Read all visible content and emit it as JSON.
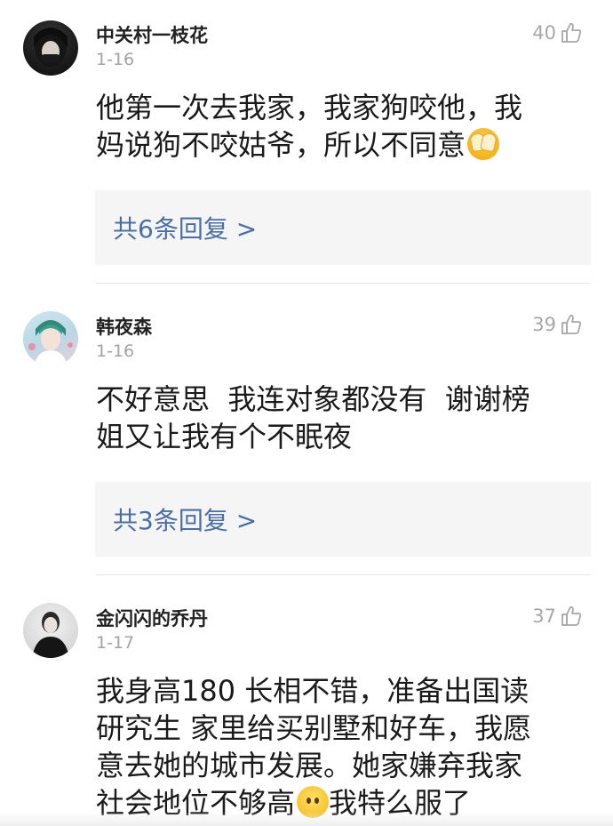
{
  "comments": [
    {
      "username": "中关村一枝花",
      "date": "1-16",
      "likes": "40",
      "avatar": "dark-hair-girl-avatar",
      "lines": [
        "他第一次去我家，我家狗咬他，我",
        "妈说狗不咬姑爷，所以不同意"
      ],
      "emoji": "face-covering-eyes-emoji",
      "replies": "共6条回复 >"
    },
    {
      "username": "韩夜森",
      "date": "1-16",
      "likes": "39",
      "avatar": "anime-character-avatar",
      "lines": [
        "不好意思  我连对象都没有  谢谢榜",
        "姐又让我有个不眠夜"
      ],
      "replies": "共3条回复 >"
    },
    {
      "username": "金闪闪的乔丹",
      "date": "1-17",
      "likes": "37",
      "avatar": "man-in-black-avatar",
      "lines": [
        "我身高180 长相不错，准备出国读",
        "研究生 家里给买别墅和好车，我愿",
        "意去她的城市发展。她家嫌弃我家",
        "社会地位不够高"
      ],
      "line4_tail": "我特么服了",
      "emoji": "shy-face-emoji"
    }
  ],
  "colors": {
    "username": "#222222",
    "meta": "#a3a3a3",
    "reply_link": "#4a6fa5",
    "reply_bg": "#f5f5f5"
  },
  "icons": {
    "like": "thumbs-up-icon"
  }
}
